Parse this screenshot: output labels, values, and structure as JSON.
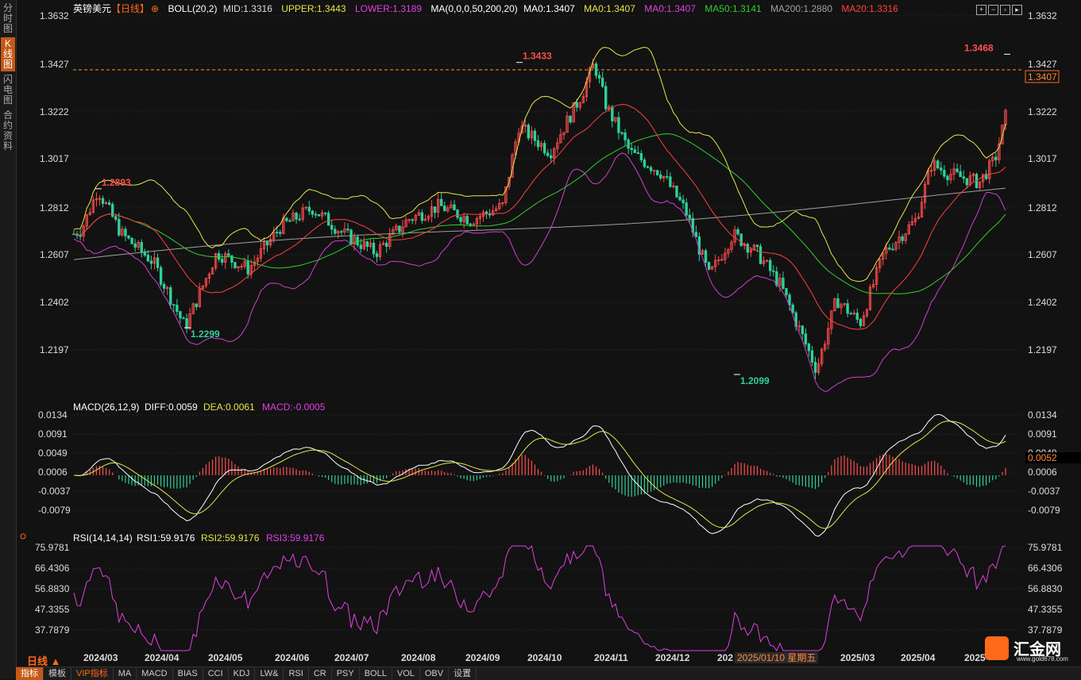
{
  "sidebar": {
    "tabs": [
      "分时图",
      "K线图",
      "闪电图",
      "合约资料"
    ]
  },
  "header": {
    "symbol": "英镑美元",
    "period_tag": "【日线】",
    "boll_label": "BOLL(20,2)",
    "boll_mid": "MID:1.3316",
    "boll_upper": "UPPER:1.3443",
    "boll_lower": "LOWER:1.3189",
    "ma_label": "MA(0,0,0,50,200,20)",
    "ma0a": "MA0:1.3407",
    "ma0b": "MA0:1.3407",
    "ma0c": "MA0:1.3407",
    "ma50": "MA50:1.3141",
    "ma200": "MA200:1.2880",
    "ma20": "MA20:1.3316"
  },
  "price_axis": [
    "1.3632",
    "1.3427",
    "1.3222",
    "1.3017",
    "1.2812",
    "1.2607",
    "1.2402",
    "1.2197"
  ],
  "current_price": "1.3407",
  "annotations": {
    "high1": "1.2893",
    "low1": "1.2299",
    "high2": "1.3433",
    "low2": "1.2099",
    "high3": "1.3468"
  },
  "macd": {
    "label": "MACD(26,12,9)",
    "diff": "DIFF:0.0059",
    "dea": "DEA:0.0061",
    "macd": "MACD:-0.0005",
    "axis": [
      "0.0134",
      "0.0091",
      "0.0049",
      "0.0006",
      "-0.0037",
      "-0.0079"
    ],
    "current": "0.0052"
  },
  "rsi": {
    "label": "RSI(14,14,14)",
    "rsi1": "RSI1:59.9176",
    "rsi2": "RSI2:59.9176",
    "rsi3": "RSI3:59.9176",
    "axis": [
      "75.9781",
      "66.4306",
      "56.8830",
      "47.3355",
      "37.7879"
    ]
  },
  "dates": [
    "2024/03",
    "2024/04",
    "2024/05",
    "2024/06",
    "2024/07",
    "2024/08",
    "2024/09",
    "2024/10",
    "2024/11",
    "2024/12",
    "202",
    "2025/03",
    "2025/04",
    "2025"
  ],
  "cursor_date": "2025/01/10 星期五",
  "period": "日线",
  "bottom_tabs": [
    "指标",
    "模板",
    "VIP指标",
    "MA",
    "MACD",
    "BIAS",
    "CCI",
    "KDJ",
    "LW&",
    "RSI",
    "CR",
    "PSY",
    "BOLL",
    "VOL",
    "OBV",
    "设置"
  ],
  "logo": {
    "name": "汇金网",
    "url": "www.gold678.com"
  },
  "colors": {
    "up": "#ff4d4d",
    "down": "#2fd09a",
    "boll": "#e6e64c",
    "lower": "#d040d0",
    "ma20": "#ff4040",
    "ma50": "#30d030",
    "ma200": "#a0a0a0",
    "accent": "#ff6a1a"
  }
}
